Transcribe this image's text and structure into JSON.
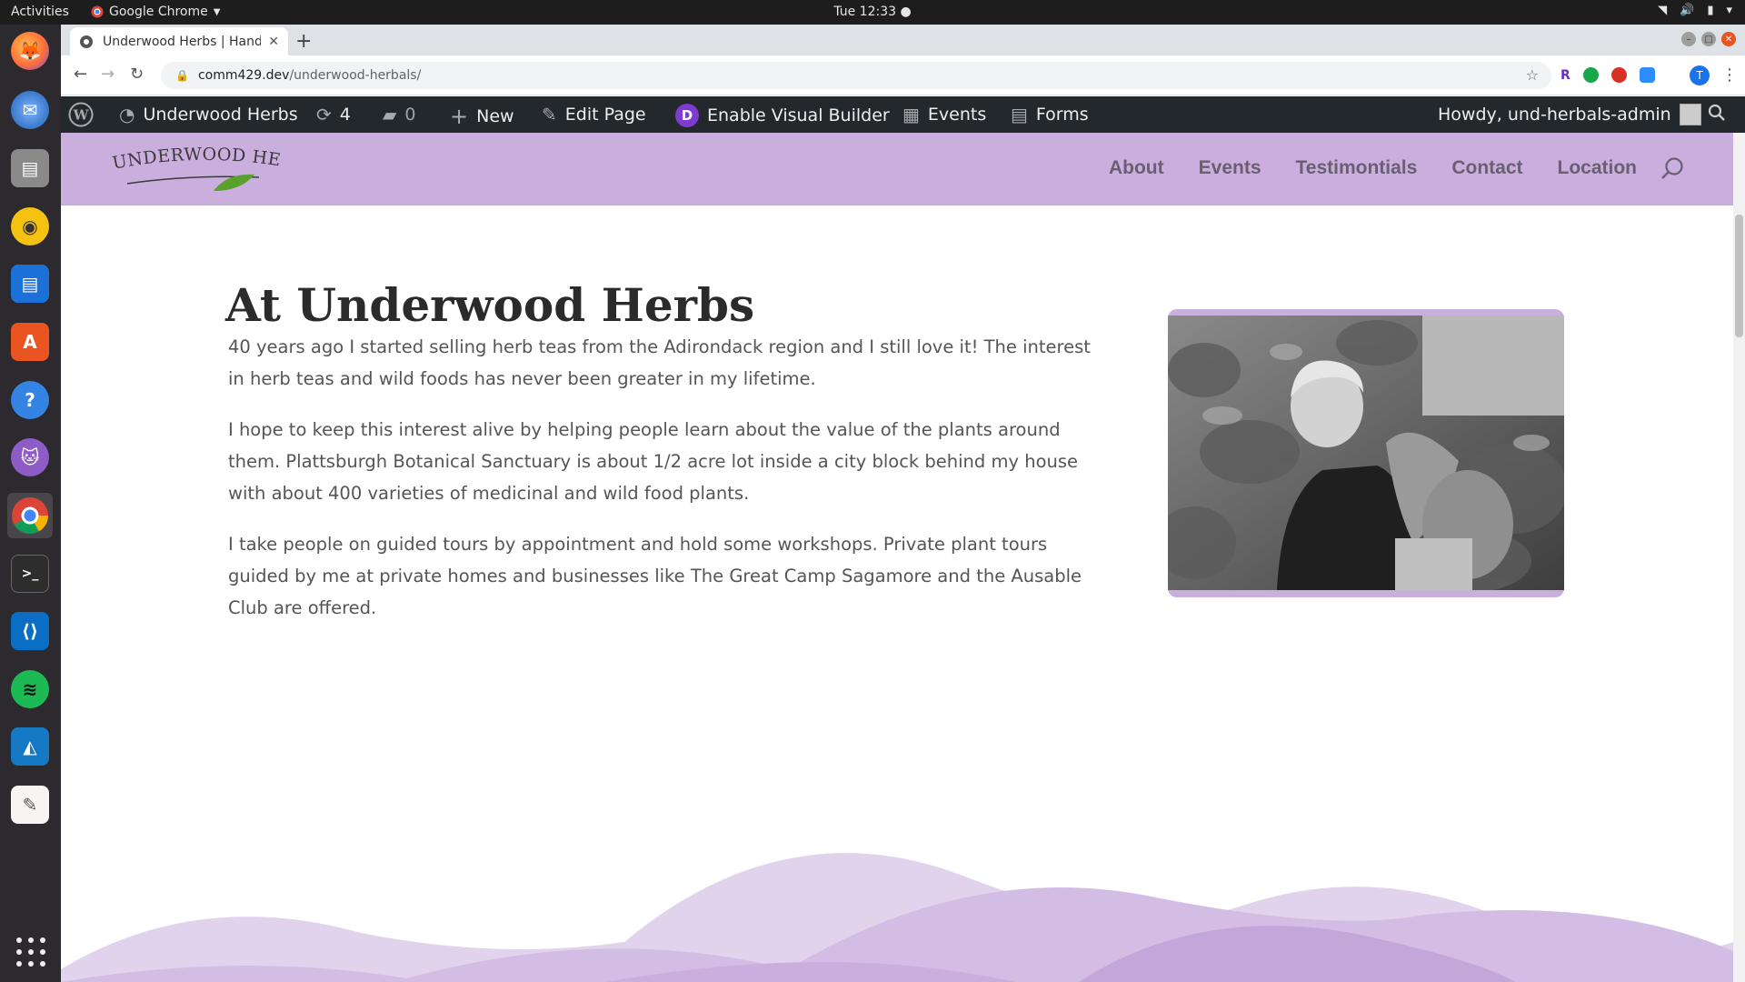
{
  "os_topbar": {
    "activities": "Activities",
    "app_name": "Google Chrome",
    "clock": "Tue 12:33 ●"
  },
  "dock": {
    "items": [
      "firefox-icon",
      "thunderbird-icon",
      "files-icon",
      "rhythmbox-icon",
      "writer-icon",
      "software-icon",
      "help-icon",
      "github-icon",
      "chrome-icon",
      "terminal-icon",
      "vscode-icon",
      "spotify-icon",
      "wireshark-icon",
      "text-editor-icon"
    ],
    "active": "chrome-icon"
  },
  "browser": {
    "tab_title": "Underwood Herbs | Hand",
    "url_host": "comm429.dev",
    "url_path": "/underwood-herbals/",
    "profile_initial": "T"
  },
  "admin_bar": {
    "site_name": "Underwood Herbs",
    "updates_count": "4",
    "comments_count": "0",
    "new_label": "New",
    "edit_label": "Edit Page",
    "divi_letter": "D",
    "visual_builder_label": "Enable Visual Builder",
    "events_label": "Events",
    "forms_label": "Forms",
    "howdy": "Howdy, und-herbals-admin"
  },
  "site": {
    "logo_text": "UNDERWOOD HERBS",
    "nav": [
      "About",
      "Events",
      "Testimontials",
      "Contact",
      "Location"
    ]
  },
  "content": {
    "title": "At Underwood Herbs",
    "paragraphs": [
      "40 years ago I started selling herb teas from the Adirondack region and I still love it! The interest in herb teas and wild foods has never been greater in my lifetime.",
      "I hope to keep this interest alive by helping people learn about the value of the plants around them. Plattsburgh Botanical Sanctuary is about 1/2 acre lot inside a city block behind my house with about 400 varieties of medicinal and wild food plants.",
      "I take people on guided tours by appointment and hold some workshops. Private plant tours guided by me at private homes and businesses like The Great Camp Sagamore and the Ausable Club are offered."
    ]
  },
  "colors": {
    "header_purple": "#c9aede",
    "admin_bar": "#23282d",
    "nav_text": "#6a5f72",
    "wave_light": "#e2d3ec",
    "wave_mid": "#c9aede"
  }
}
